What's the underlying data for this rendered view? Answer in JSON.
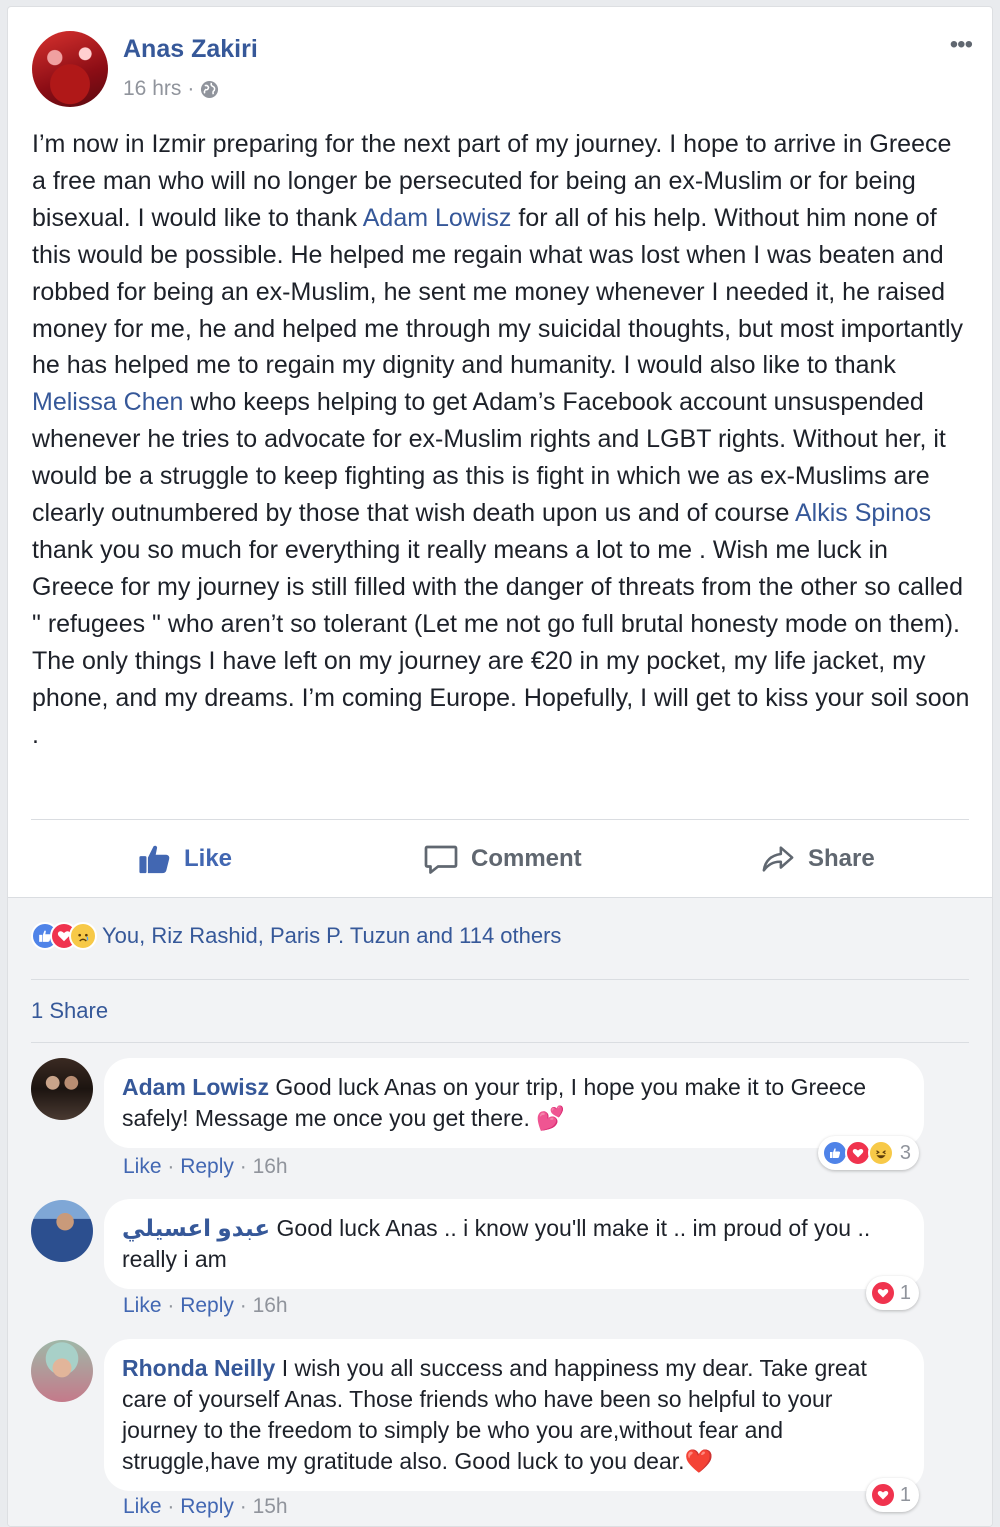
{
  "post": {
    "author": "Anas Zakiri",
    "time": "16 hrs",
    "meta_separator": "·",
    "text_segments": [
      {
        "text": "I’m now in Izmir preparing for the next part of my journey. I hope to arrive in Greece a free man who will no longer be persecuted for being an ex-Muslim or for being bisexual. I would like to thank ",
        "type": "plain"
      },
      {
        "text": "Adam Lowisz",
        "type": "mention"
      },
      {
        "text": " for all of his help. Without him none of this would be possible. He helped me regain what was lost when I was beaten and robbed for being an ex-Muslim, he sent me money whenever I needed it, he raised money for me, he and helped me through my suicidal thoughts, but most importantly he has helped me to regain my dignity and humanity. I would also like to thank ",
        "type": "plain"
      },
      {
        "text": "Melissa Chen",
        "type": "mention"
      },
      {
        "text": " who keeps helping to get Adam’s Facebook account unsuspended whenever he tries to advocate for ex-Muslim rights and LGBT rights. Without her, it would be a struggle to keep fighting as this is fight in which we as ex-Muslims are clearly outnumbered by those that wish death upon us and of course ",
        "type": "plain"
      },
      {
        "text": "Alkis Spinos",
        "type": "mention"
      },
      {
        "text": " thank you so much for everything it really means a lot to me . Wish me luck in Greece for my journey is still filled with the danger of threats from the other so called \" refugees \" who aren’t so tolerant (Let me not go full brutal honesty mode on them). The only things I have left on my journey are €20 in my pocket, my life jacket, my phone, and my dreams. I’m coming Europe. Hopefully, I will get to kiss your soil soon .",
        "type": "plain"
      }
    ]
  },
  "actions": {
    "like": "Like",
    "comment": "Comment",
    "share": "Share"
  },
  "reactions": {
    "summary": "You, Riz Rashid, Paris P. Tuzun and 114 others",
    "icons": [
      "like-icon",
      "love-icon",
      "sad-icon"
    ]
  },
  "shares": {
    "label": "1 Share"
  },
  "comments": [
    {
      "name": "Adam Lowisz",
      "text": " Good luck Anas on your trip, I hope you make it to Greece safely! Message me once you get there. 💕",
      "like": "Like",
      "reply": "Reply",
      "time": "16h",
      "reaction_count": "3",
      "reaction_icons": [
        "like-icon",
        "love-icon",
        "haha-icon"
      ]
    },
    {
      "name": "عبدو اعسيلي",
      "text": " Good luck Anas .. i know you'll make it .. im proud of you .. really i am",
      "like": "Like",
      "reply": "Reply",
      "time": "16h",
      "reaction_count": "1",
      "reaction_icons": [
        "love-icon"
      ]
    },
    {
      "name": "Rhonda Neilly",
      "text": " I wish you all success and happiness my dear. Take great care of yourself Anas. Those friends who have been so helpful to your journey to the freedom to simply be who you are,without fear and struggle,have my gratitude also. Good luck to you dear.❤️",
      "like": "Like",
      "reply": "Reply",
      "time": "15h",
      "reaction_count": "1",
      "reaction_icons": [
        "love-icon"
      ]
    }
  ],
  "colors": {
    "link": "#365899",
    "like_blue": "#4267b2",
    "love_red": "#f0334e",
    "secondary_text": "#90949c"
  }
}
